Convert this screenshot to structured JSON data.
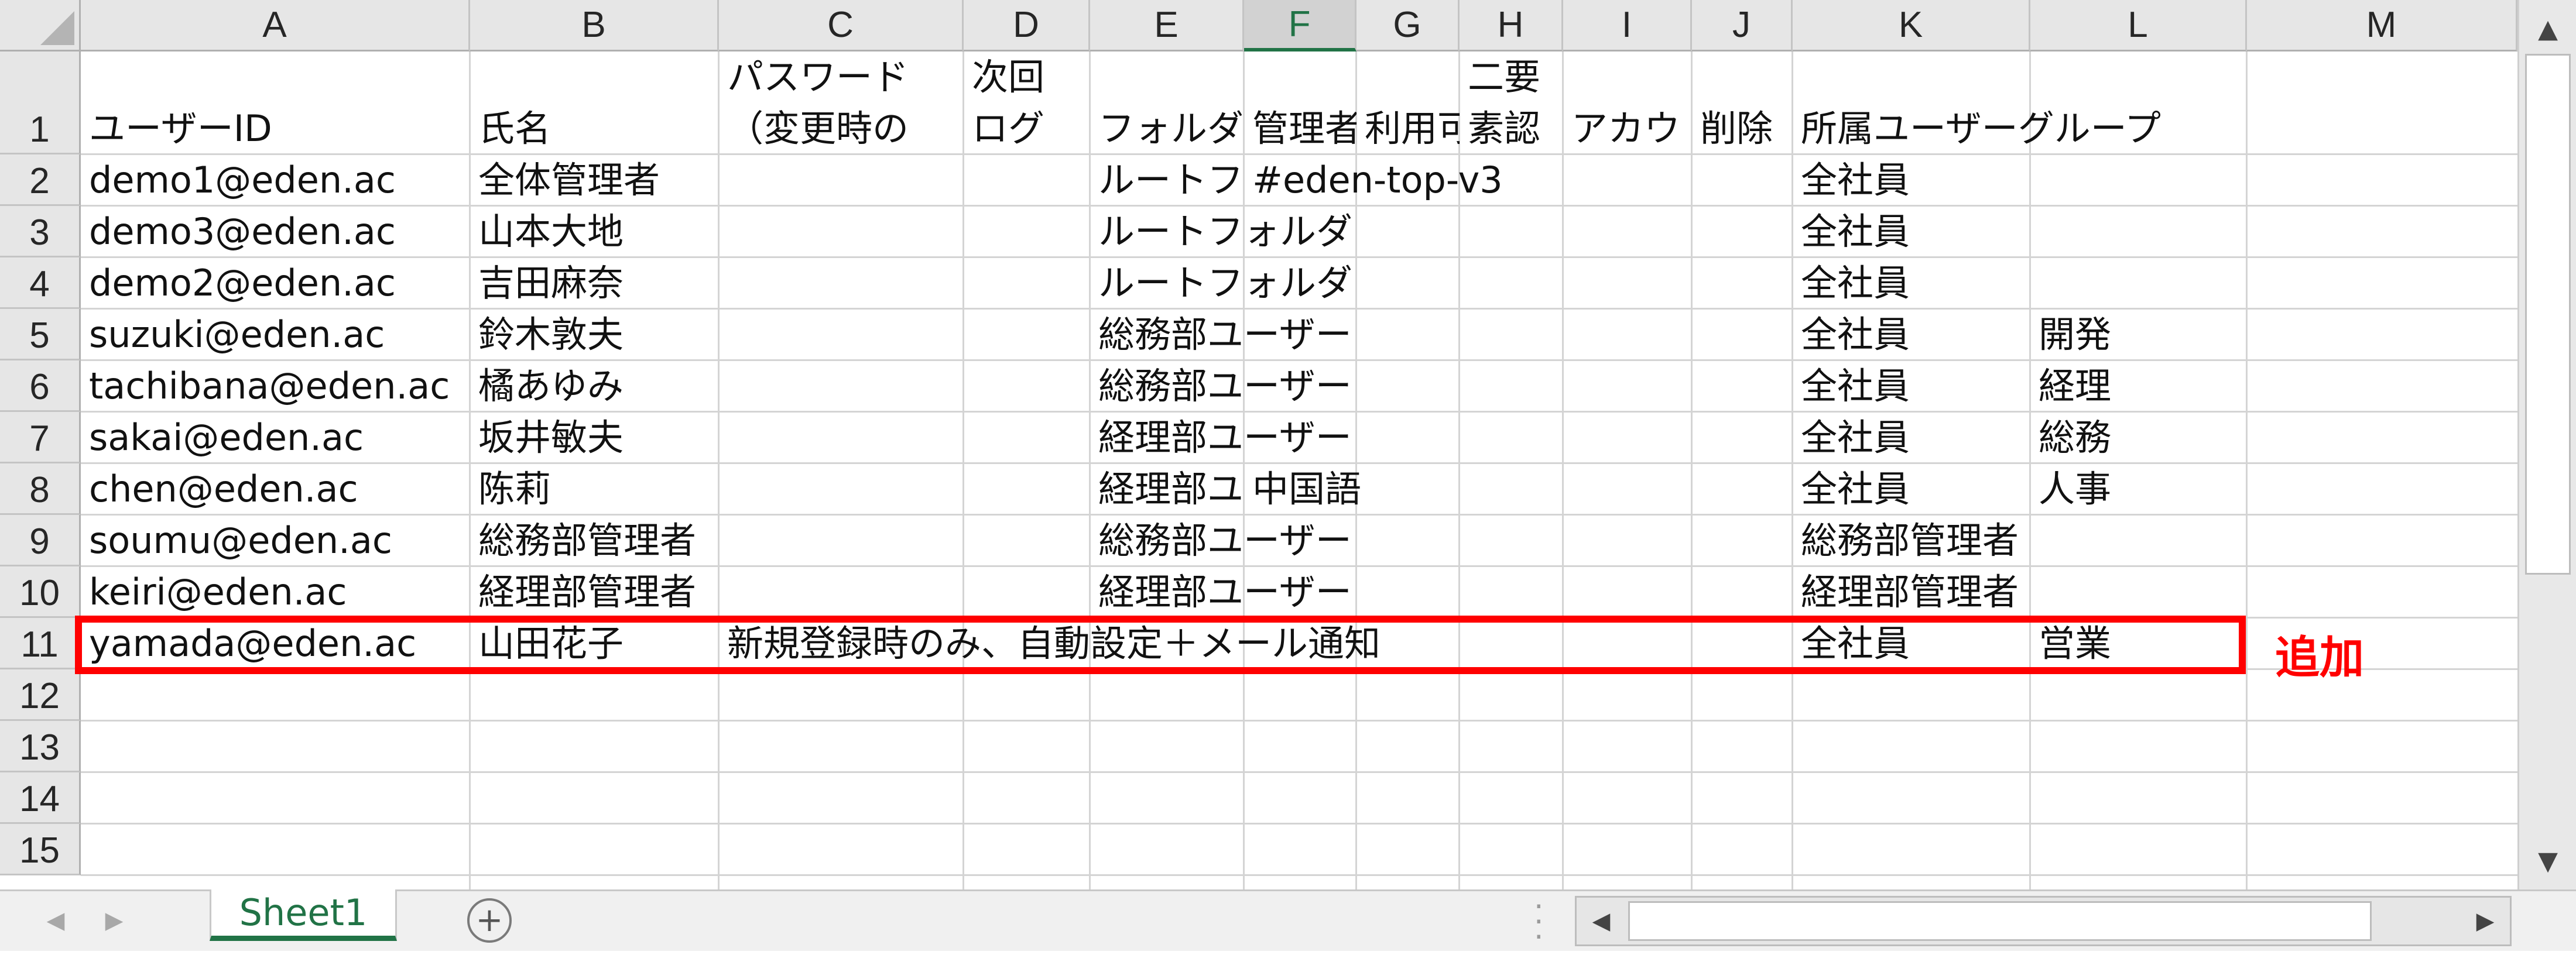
{
  "columns": [
    "A",
    "B",
    "C",
    "D",
    "E",
    "F",
    "G",
    "H",
    "I",
    "J",
    "K",
    "L",
    "M"
  ],
  "selected_column": "F",
  "rows": [
    "1",
    "2",
    "3",
    "4",
    "5",
    "6",
    "7",
    "8",
    "9",
    "10",
    "11",
    "12",
    "13",
    "14",
    "15"
  ],
  "header_row": {
    "A": "ユーザーID",
    "B": "氏名",
    "C": [
      "パスワード",
      "（変更時の"
    ],
    "D": [
      "次回",
      "ログ"
    ],
    "E": "フォルダ",
    "F": "管理者",
    "G": "利用可",
    "H": [
      "二要",
      "素認"
    ],
    "I": "アカウ",
    "J": "削除",
    "K": "所属ユーザーグループ"
  },
  "data_rows": [
    {
      "A": "demo1@eden.ac",
      "B": "全体管理者",
      "E": "ルートフ",
      "F": "#eden-top-v3",
      "K": "全社員",
      "L": ""
    },
    {
      "A": "demo3@eden.ac",
      "B": "山本大地",
      "E": "ルートフォルダ",
      "F": "",
      "K": "全社員",
      "L": ""
    },
    {
      "A": "demo2@eden.ac",
      "B": "吉田麻奈",
      "E": "ルートフォルダ",
      "F": "",
      "K": "全社員",
      "L": ""
    },
    {
      "A": "suzuki@eden.ac",
      "B": "鈴木敦夫",
      "E": "総務部ユーザー",
      "F": "",
      "K": "全社員",
      "L": "開発"
    },
    {
      "A": "tachibana@eden.ac",
      "B": "橘あゆみ",
      "E": "総務部ユーザー",
      "F": "",
      "K": "全社員",
      "L": "経理"
    },
    {
      "A": "sakai@eden.ac",
      "B": "坂井敏夫",
      "E": "経理部ユーザー",
      "F": "",
      "K": "全社員",
      "L": "総務"
    },
    {
      "A": "chen@eden.ac",
      "B": "陈莉",
      "E": "経理部ユーザ",
      "F": "中国語",
      "K": "全社員",
      "L": "人事"
    },
    {
      "A": "soumu@eden.ac",
      "B": "総務部管理者",
      "E": "総務部ユーザー",
      "F": "",
      "K": "総務部管理者",
      "L": ""
    },
    {
      "A": "keiri@eden.ac",
      "B": "経理部管理者",
      "E": "経理部ユーザー",
      "F": "",
      "K": "経理部管理者",
      "L": ""
    },
    {
      "A": "yamada@eden.ac",
      "B": "山田花子",
      "C": "新規登録時のみ、自動設定＋メール通知",
      "K": "全社員",
      "L": "営業"
    }
  ],
  "annotation": "追加",
  "sheet_tab": "Sheet1",
  "icons": {
    "scroll_up": "triangle-up-icon",
    "scroll_down": "triangle-down-icon",
    "scroll_left": "triangle-left-icon",
    "scroll_right": "triangle-right-icon",
    "add_sheet": "plus-circle-icon"
  },
  "colors": {
    "accent": "#217346",
    "highlight": "#ff0000"
  }
}
